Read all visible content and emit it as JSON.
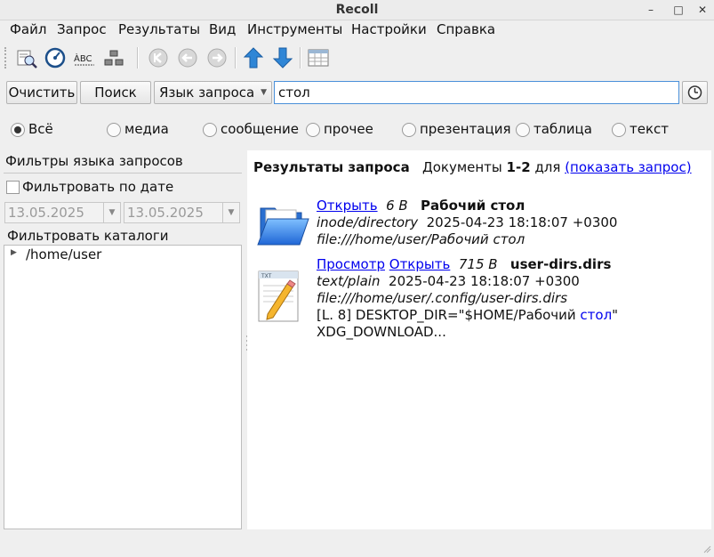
{
  "window": {
    "title": "Recoll",
    "minimize": "–",
    "maximize": "□",
    "close": "✕"
  },
  "menu": [
    "Файл",
    "Запрос",
    "Результаты",
    "Вид",
    "Инструменты",
    "Настройки",
    "Справка"
  ],
  "toolbar_icons": [
    "search-tool-icon",
    "index-gauge-icon",
    "spelling-icon",
    "hierarchy-icon",
    "first-page-icon",
    "prev-page-icon",
    "next-page-icon",
    "sort-up-icon",
    "sort-down-icon",
    "table-view-icon"
  ],
  "search": {
    "clear_label": "Очистить",
    "search_label": "Поиск",
    "mode_label": "Язык запроса",
    "query": "стол",
    "history_icon": "clock-icon"
  },
  "categories": [
    {
      "label": "Всё",
      "selected": true
    },
    {
      "label": "медиа",
      "selected": false
    },
    {
      "label": "сообщение",
      "selected": false
    },
    {
      "label": "прочее",
      "selected": false
    },
    {
      "label": "презентация",
      "selected": false
    },
    {
      "label": "таблица",
      "selected": false
    },
    {
      "label": "текст",
      "selected": false
    }
  ],
  "filters": {
    "header": "Фильтры языка запросов",
    "date_checkbox_label": "Фильтровать по дате",
    "date_from": "13.05.2025",
    "date_to": "13.05.2025",
    "dirs_header": "Фильтровать каталоги",
    "tree_root": "/home/user"
  },
  "results": {
    "title": "Результаты запроса",
    "docs_prefix": "Документы",
    "range": "1-2",
    "for_word": "для",
    "show_query_link": "(показать запрос)",
    "items": [
      {
        "icon": "folder-icon",
        "links": [
          "Открыть"
        ],
        "size": "6 B",
        "name": "Рабочий стол",
        "mime": "inode/directory",
        "date": "2025-04-23 18:18:07 +0300",
        "url": "file:///home/user/Рабочий стол"
      },
      {
        "icon": "text-file-icon",
        "links": [
          "Просмотр",
          "Открыть"
        ],
        "size": "715 B",
        "name": "user-dirs.dirs",
        "mime": "text/plain",
        "date": "2025-04-23 18:18:07 +0300",
        "url": "file:///home/user/.config/user-dirs.dirs",
        "snippet_before": "[L. 8] DESKTOP_DIR=\"$HOME/Рабочий ",
        "snippet_match": "стол",
        "snippet_after": "\"",
        "snippet_line2": "XDG_DOWNLOAD..."
      }
    ]
  }
}
